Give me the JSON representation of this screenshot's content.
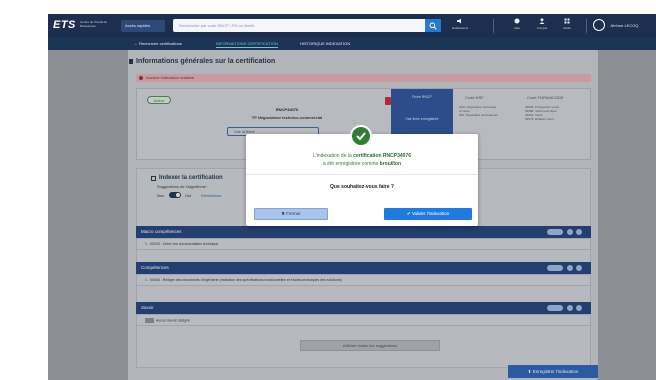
{
  "header": {
    "brand": "ETS",
    "brand_sub": "Centre de Travail de Ressources",
    "acces_label": "Accès rapides",
    "search_placeholder": "Rechercher par code RNCP / RS ou libellé",
    "nav": [
      {
        "icon": "speaker-icon",
        "label": "Notifications"
      },
      {
        "icon": "circle-icon",
        "label": "Aide"
      },
      {
        "icon": "person-icon",
        "label": "Compte"
      },
      {
        "icon": "grid-icon",
        "label": "Outils"
      }
    ],
    "user_name": "Jérôme LECOQ"
  },
  "subnav": {
    "back_label": "Recherche certifications",
    "tabs": [
      {
        "label": "INFORMATIONS CERTIFICATION",
        "active": true
      },
      {
        "label": "HISTORIQUE INDEXATION",
        "active": false
      }
    ]
  },
  "page": {
    "section_title": "Informations générales sur la certification",
    "alert_text": "Aucune indexation réalisée",
    "status_badge": "Active",
    "rncp_code": "RNCP34076",
    "cert_title": "TP Négociateur technico-commercial",
    "link_label": "Voir la fiche",
    "blue_panel_top": "Fiche RNCP",
    "blue_panel_bottom": "Voir fiche enregistrée",
    "col1_head": "Code NSF",
    "col1_lines": [
      "312t: Négociation technique",
      "et vente",
      "300: Spécialités plurivalentes"
    ],
    "col2_head": "Code FORMACODE",
    "col2_lines": [
      "34566: Prospection vente",
      "34588: Vente technique",
      "34054: Vente",
      "34573: Relation client"
    ],
    "index_title": "Indexer la certification",
    "suggest_label": "Suggestions de l'algorithme :",
    "toggle_non": "Non",
    "toggle_oui": "Oui",
    "toggle_link": "Réinitialiser",
    "groups": [
      {
        "title": "Macro compétences",
        "row": "1 - 00043 : Créer une documentation technique"
      },
      {
        "title": "Compétences",
        "row": "1 - 00046 : Rédiger des documents d'ingénierie (rédaction des spécifications fonctionnelles et études techniques des solutions)"
      },
      {
        "title": "Savoir",
        "row": "Aucun Savoir désigné"
      }
    ],
    "afficher_label": "Afficher toutes les suggestions",
    "save_label": "Enregistrer l'indexation"
  },
  "modal": {
    "msg_line1_prefix": "L'indexation de la ",
    "msg_line1_bold": "certification RNCP34076",
    "msg_line2_prefix": "a été enregistrée comme ",
    "msg_line2_bold": "brouillon",
    "question": "Que souhaitez-vous faire ?",
    "close_label": "Fermer",
    "validate_label": "Valider l'indexation"
  },
  "colors": {
    "topbar": "#1c2f4e",
    "accent_blue": "#1f7be0",
    "success_green": "#2f7f33"
  }
}
